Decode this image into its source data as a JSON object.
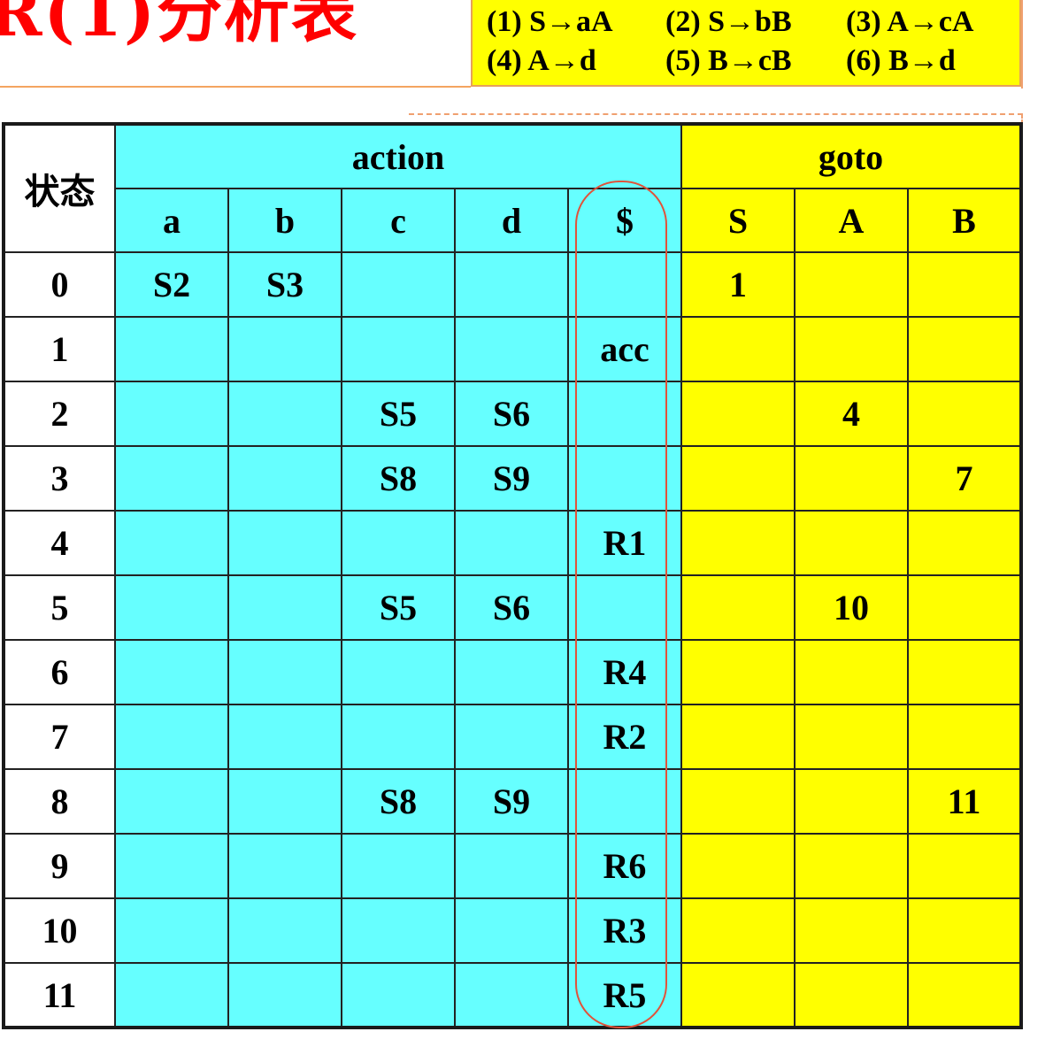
{
  "title": "R(1)分析表",
  "grammar": {
    "productions": [
      "(1) S→aA",
      "(2) S→bB",
      "(3) A→cA",
      "(4) A→d",
      "(5) B→cB",
      "(6) B→d"
    ]
  },
  "table": {
    "state_header": "状态",
    "group_action": "action",
    "group_goto": "goto",
    "action_columns": [
      "a",
      "b",
      "c",
      "d",
      "$"
    ],
    "goto_columns": [
      "S",
      "A",
      "B"
    ],
    "rows": [
      {
        "state": "0",
        "action": [
          "S2",
          "S3",
          "",
          "",
          ""
        ],
        "goto": [
          "1",
          "",
          ""
        ]
      },
      {
        "state": "1",
        "action": [
          "",
          "",
          "",
          "",
          "acc"
        ],
        "goto": [
          "",
          "",
          ""
        ]
      },
      {
        "state": "2",
        "action": [
          "",
          "",
          "S5",
          "S6",
          ""
        ],
        "goto": [
          "",
          "4",
          ""
        ]
      },
      {
        "state": "3",
        "action": [
          "",
          "",
          "S8",
          "S9",
          ""
        ],
        "goto": [
          "",
          "",
          "7"
        ]
      },
      {
        "state": "4",
        "action": [
          "",
          "",
          "",
          "",
          "R1"
        ],
        "goto": [
          "",
          "",
          ""
        ]
      },
      {
        "state": "5",
        "action": [
          "",
          "",
          "S5",
          "S6",
          ""
        ],
        "goto": [
          "",
          "10",
          ""
        ]
      },
      {
        "state": "6",
        "action": [
          "",
          "",
          "",
          "",
          "R4"
        ],
        "goto": [
          "",
          "",
          ""
        ]
      },
      {
        "state": "7",
        "action": [
          "",
          "",
          "",
          "",
          "R2"
        ],
        "goto": [
          "",
          "",
          ""
        ]
      },
      {
        "state": "8",
        "action": [
          "",
          "",
          "S8",
          "S9",
          ""
        ],
        "goto": [
          "",
          "",
          "11"
        ]
      },
      {
        "state": "9",
        "action": [
          "",
          "",
          "",
          "",
          "R6"
        ],
        "goto": [
          "",
          "",
          ""
        ]
      },
      {
        "state": "10",
        "action": [
          "",
          "",
          "",
          "",
          "R3"
        ],
        "goto": [
          "",
          "",
          ""
        ]
      },
      {
        "state": "11",
        "action": [
          "",
          "",
          "",
          "",
          "R5"
        ],
        "goto": [
          "",
          "",
          ""
        ]
      }
    ]
  },
  "colors": {
    "action_bg": "#66ffff",
    "goto_bg": "#ffff00",
    "title": "#ff0000",
    "highlight_oval": "#e0533a"
  }
}
